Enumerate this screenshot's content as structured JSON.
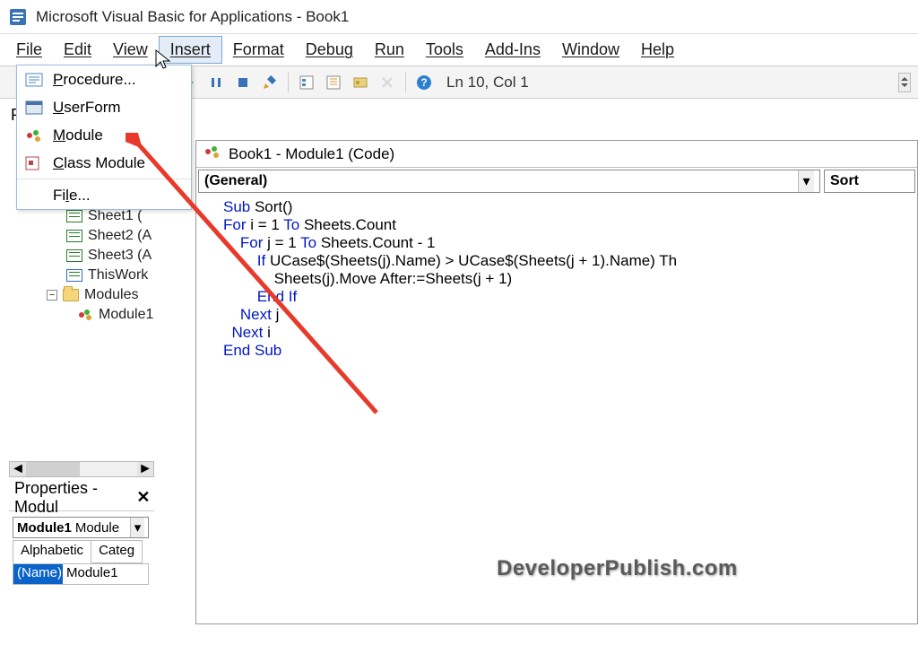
{
  "title": "Microsoft Visual Basic for Applications - Book1",
  "menus": {
    "file": "File",
    "edit": "Edit",
    "view": "View",
    "insert": "Insert",
    "format": "Format",
    "debug": "Debug",
    "run": "Run",
    "tools": "Tools",
    "addins": "Add-Ins",
    "window": "Window",
    "help": "Help"
  },
  "status": "Ln 10, Col 1",
  "insertItems": {
    "procedure": "Procedure...",
    "userform": "UserForm",
    "module": "Module",
    "classmodule": "Class Module",
    "file": "File..."
  },
  "tree": {
    "sheet1": "Sheet1 (",
    "sheet2": "Sheet2 (A",
    "sheet3": "Sheet3 (A",
    "thiswork": "ThisWork",
    "modules": "Modules",
    "module1": "Module1"
  },
  "properties": {
    "title": "Properties - Modul",
    "comboBold": "Module1",
    "comboNorm": "Module",
    "tabAlpha": "Alphabetic",
    "tabCateg": "Categ",
    "nameKey": "(Name)",
    "nameVal": "Module1"
  },
  "codeWindow": {
    "title": "Book1 - Module1 (Code)",
    "leftSel": "(General)",
    "rightSel": "Sort",
    "code": [
      "Sub Sort()",
      "For i = 1 To Sheets.Count",
      "    For j = 1 To Sheets.Count - 1",
      "        If UCase$(Sheets(j).Name) > UCase$(Sheets(j + 1).Name) Th",
      "            Sheets(j).Move After:=Sheets(j + 1)",
      "        End If",
      "    Next j",
      "  Next i",
      "End Sub"
    ]
  },
  "watermark": "DeveloperPublish.com",
  "sidebarLabel": "P"
}
